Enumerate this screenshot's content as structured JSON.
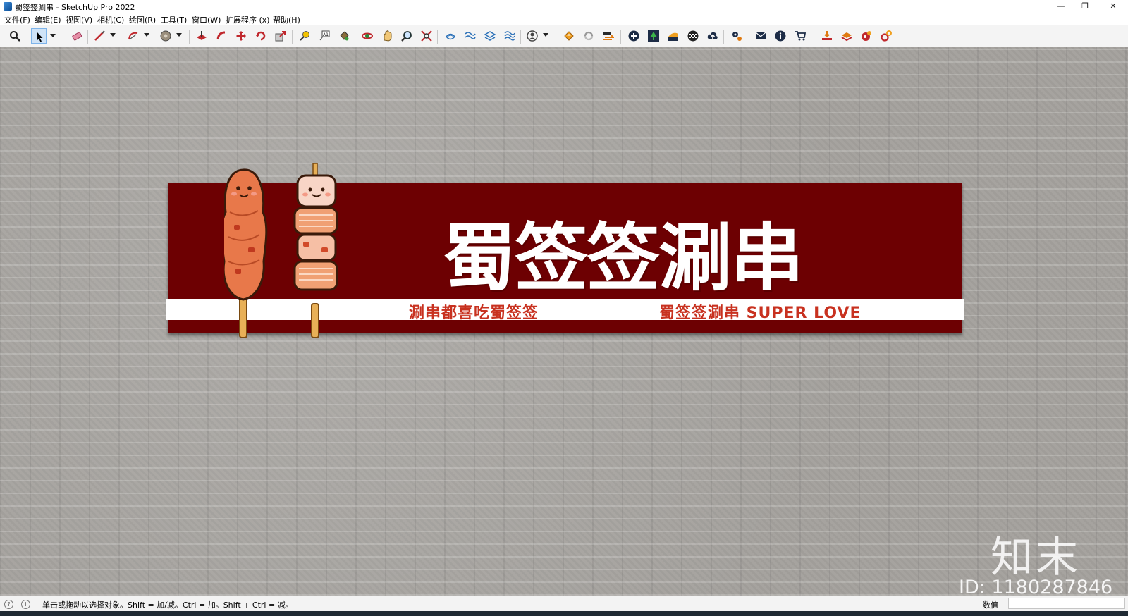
{
  "window": {
    "title": "蜀签签涮串 - SketchUp Pro 2022",
    "minimize": "—",
    "maximize": "❐",
    "close": "✕"
  },
  "menu": [
    {
      "label": "文件(F)"
    },
    {
      "label": "编辑(E)"
    },
    {
      "label": "视图(V)"
    },
    {
      "label": "相机(C)"
    },
    {
      "label": "绘图(R)"
    },
    {
      "label": "工具(T)"
    },
    {
      "label": "窗口(W)"
    },
    {
      "label": "扩展程序 (x)"
    },
    {
      "label": "帮助(H)"
    }
  ],
  "toolbar": {
    "tools": [
      "zoom-extents-icon",
      "select-icon",
      "eraser-icon",
      "line-icon",
      "arc-icon",
      "shapes-icon",
      "push-pull-icon",
      "follow-me-icon",
      "move-icon",
      "rotate-icon",
      "scale-icon",
      "tape-measure-icon",
      "text-icon",
      "paint-bucket-icon",
      "orbit-icon",
      "pan-icon",
      "zoom-icon",
      "zoom-window-icon",
      "sandbox-icon-1",
      "sandbox-icon-2",
      "sandbox-icon-3",
      "sandbox-icon-4",
      "profile-icon",
      "extension-icon-1",
      "reload-icon",
      "swap-icon",
      "add-icon",
      "tree-icon",
      "layers-icon",
      "checker-icon",
      "upload-cloud-icon",
      "gears-icon",
      "mail-icon",
      "info-icon",
      "cart-icon",
      "import-icon",
      "export-icon",
      "render-icon",
      "settings-icon"
    ]
  },
  "sign": {
    "title": "蜀签签涮串",
    "slogan_left": "涮串都喜吃蜀签签",
    "slogan_right": "蜀签签涮串 SUPER LOVE",
    "board_color": "#6d0002",
    "slogan_color": "#c8311f"
  },
  "watermark": {
    "logo": "知末",
    "id": "ID: 1180287846"
  },
  "status": {
    "message": "单击或拖动以选择对象。Shift = 加/减。Ctrl = 加。Shift + Ctrl = 减。",
    "measurements_label": "数值",
    "measurements_value": ""
  }
}
